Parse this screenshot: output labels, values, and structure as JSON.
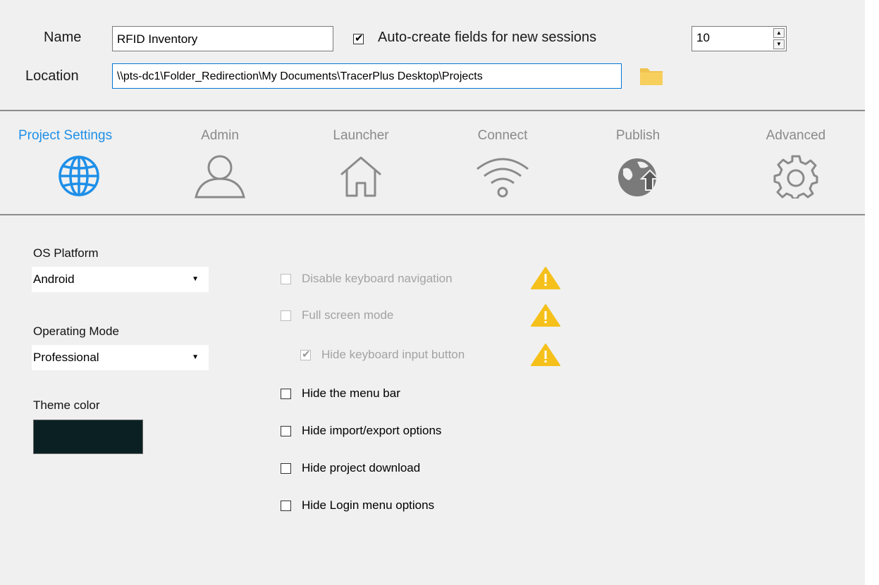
{
  "header": {
    "name_label": "Name",
    "name_value": "RFID Inventory",
    "auto_create_label": "Auto-create fields for new sessions",
    "auto_create_checked": true,
    "auto_create_count": "10",
    "location_label": "Location",
    "location_value": "\\\\pts-dc1\\Folder_Redirection\\My Documents\\TracerPlus Desktop\\Projects",
    "folder_icon": "folder-icon"
  },
  "tabs": [
    {
      "label": "Project Settings",
      "icon": "globe-icon",
      "active": true
    },
    {
      "label": "Admin",
      "icon": "user-icon",
      "active": false
    },
    {
      "label": "Launcher",
      "icon": "home-icon",
      "active": false
    },
    {
      "label": "Connect",
      "icon": "wifi-icon",
      "active": false
    },
    {
      "label": "Publish",
      "icon": "publish-globe-icon",
      "active": false
    },
    {
      "label": "Advanced",
      "icon": "gear-icon",
      "active": false
    }
  ],
  "settings": {
    "os_platform_label": "OS Platform",
    "os_platform_value": "Android",
    "operating_mode_label": "Operating Mode",
    "operating_mode_value": "Professional",
    "theme_color_label": "Theme color",
    "theme_color": "#0b2023"
  },
  "options": [
    {
      "label": "Disable keyboard navigation",
      "checked": false,
      "disabled": true,
      "warning": true
    },
    {
      "label": "Full screen mode",
      "checked": false,
      "disabled": true,
      "warning": true
    },
    {
      "label": "Hide keyboard input button",
      "checked": true,
      "disabled": true,
      "warning": true
    },
    {
      "label": "Hide the menu bar",
      "checked": false,
      "disabled": false,
      "warning": false
    },
    {
      "label": "Hide import/export options",
      "checked": false,
      "disabled": false,
      "warning": false
    },
    {
      "label": "Hide project download",
      "checked": false,
      "disabled": false,
      "warning": false
    },
    {
      "label": "Hide Login menu options",
      "checked": false,
      "disabled": false,
      "warning": false
    }
  ],
  "colors": {
    "accent": "#1e8fe8",
    "warning": "#f5c01a",
    "panel_bg": "#f0f0f0"
  }
}
